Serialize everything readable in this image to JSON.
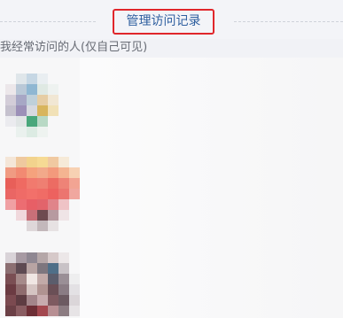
{
  "header": {
    "manage_label": "管理访问记录"
  },
  "section": {
    "title": "我经常访问的人(仅自己可见)"
  },
  "visitors": [
    {
      "name": ""
    },
    {
      "name": ""
    },
    {
      "name": ""
    }
  ]
}
